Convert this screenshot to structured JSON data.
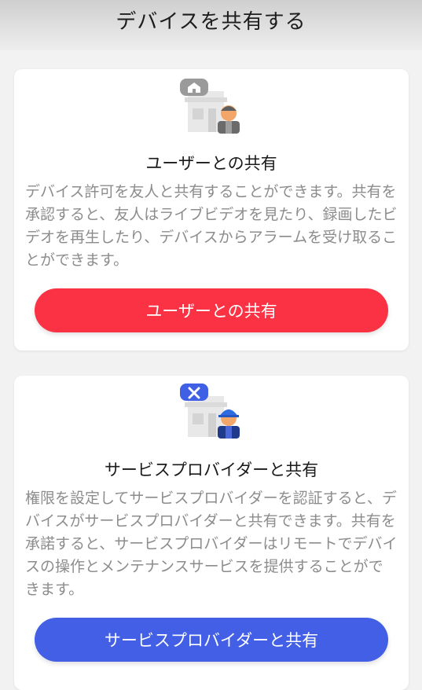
{
  "header": {
    "title": "デバイスを共有する"
  },
  "cards": [
    {
      "icon": "home-icon",
      "title": "ユーザーとの共有",
      "description": "デバイス許可を友人と共有することができます。共有を承認すると、友人はライブビデオを見たり、録画したビデオを再生したり、デバイスからアラームを受け取ることができます。",
      "button_label": "ユーザーとの共有",
      "button_color": "#fa3243"
    },
    {
      "icon": "tools-icon",
      "title": "サービスプロバイダーと共有",
      "description": "権限を設定してサービスプロバイダーを認証すると、デバイスがサービスプロバイダーと共有できます。共有を承諾すると、サービスプロバイダーはリモートでデバイスの操作とメンテナンスサービスを提供することができます。",
      "button_label": "サービスプロバイダーと共有",
      "button_color": "#425fe6"
    }
  ]
}
